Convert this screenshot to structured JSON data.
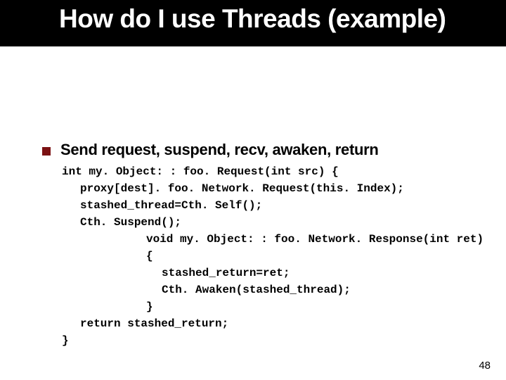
{
  "title": "How do I use Threads (example)",
  "bullet": "Send request, suspend, recv, awaken, return",
  "code": {
    "l0": "int my. Object: : foo. Request(int src) {",
    "l1": "proxy[dest]. foo. Network. Request(this. Index);",
    "l2": "stashed_thread=Cth. Self();",
    "l3": "Cth. Suspend();",
    "l4": "void my. Object: : foo. Network. Response(int ret) {",
    "l5": "stashed_return=ret;",
    "l6": "Cth. Awaken(stashed_thread);",
    "l7": "}",
    "l8": "return stashed_return;",
    "l9": "}"
  },
  "page_number": "48"
}
